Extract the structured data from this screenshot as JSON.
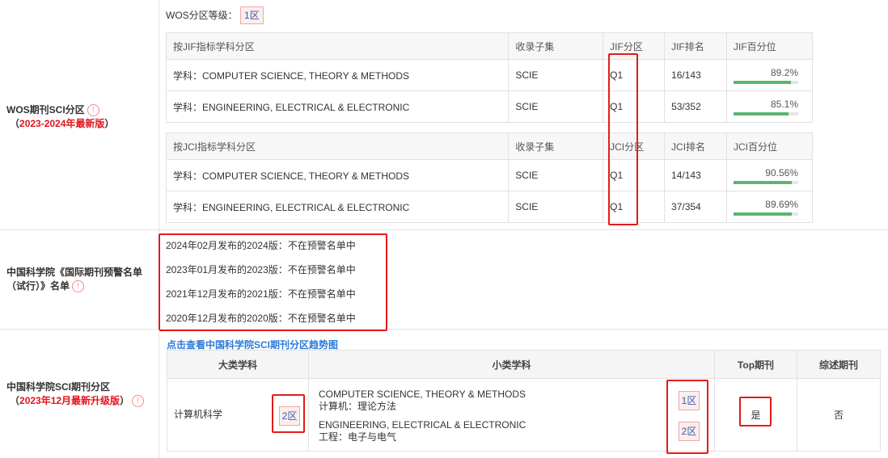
{
  "wos": {
    "title": "WOS期刊SCI分区",
    "subtitle": "2023-2024年最新版",
    "level_label": "WOS分区等级：",
    "level_value": "1区",
    "jif_header": [
      "按JIF指标学科分区",
      "收录子集",
      "JIF分区",
      "JIF排名",
      "JIF百分位"
    ],
    "jif_rows": [
      {
        "subject": "学科：COMPUTER SCIENCE, THEORY & METHODS",
        "set": "SCIE",
        "q": "Q1",
        "rank": "16/143",
        "pct": "89.2%",
        "pct_value": 89.2
      },
      {
        "subject": "学科：ENGINEERING, ELECTRICAL & ELECTRONIC",
        "set": "SCIE",
        "q": "Q1",
        "rank": "53/352",
        "pct": "85.1%",
        "pct_value": 85.1
      }
    ],
    "jci_header": [
      "按JCI指标学科分区",
      "收录子集",
      "JCI分区",
      "JCI排名",
      "JCI百分位"
    ],
    "jci_rows": [
      {
        "subject": "学科：COMPUTER SCIENCE, THEORY & METHODS",
        "set": "SCIE",
        "q": "Q1",
        "rank": "14/143",
        "pct": "90.56%",
        "pct_value": 90.56
      },
      {
        "subject": "学科：ENGINEERING, ELECTRICAL & ELECTRONIC",
        "set": "SCIE",
        "q": "Q1",
        "rank": "37/354",
        "pct": "89.69%",
        "pct_value": 89.69
      }
    ]
  },
  "warning": {
    "title": "中国科学院《国际期刊预警名单（试行）》名单",
    "items": [
      "2024年02月发布的2024版：不在预警名单中",
      "2023年01月发布的2023版：不在预警名单中",
      "2021年12月发布的2021版：不在预警名单中",
      "2020年12月发布的2020版：不在预警名单中"
    ]
  },
  "cas": {
    "title": "中国科学院SCI期刊分区",
    "subtitle": "2023年12月最新升级版",
    "link": "点击查看中国科学院SCI期刊分区趋势图",
    "header": [
      "大类学科",
      "小类学科",
      "Top期刊",
      "综述期刊"
    ],
    "major": "计算机科学",
    "major_zone": "2区",
    "minors": [
      {
        "en": "COMPUTER SCIENCE, THEORY & METHODS",
        "cn": "计算机：理论方法",
        "zone": "1区"
      },
      {
        "en": "ENGINEERING, ELECTRICAL & ELECTRONIC",
        "cn": "工程：电子与电气",
        "zone": "2区"
      }
    ],
    "top": "是",
    "review": "否"
  },
  "icons": {
    "info": "!"
  },
  "colors": {
    "accent_red": "#e41b1b",
    "bar_green": "#5db570",
    "link_blue": "#2c7bd8"
  }
}
